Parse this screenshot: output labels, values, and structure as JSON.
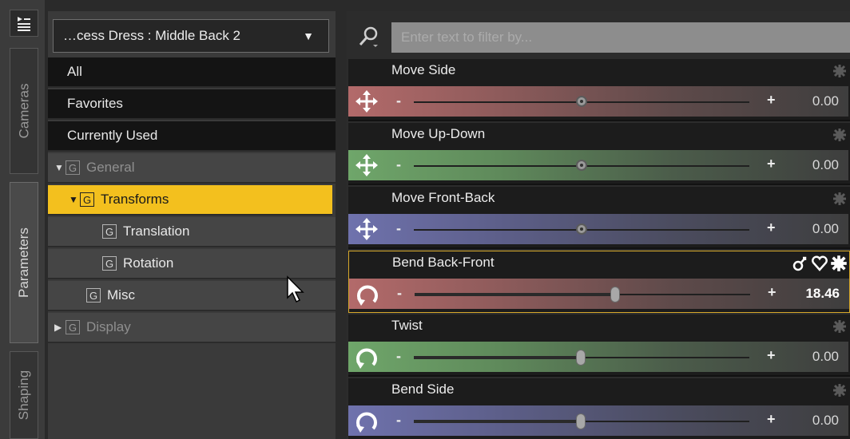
{
  "tabs": [
    {
      "label": "Cameras",
      "icon": "cameras-tab"
    },
    {
      "label": "Parameters",
      "icon": "parameters-tab"
    },
    {
      "label": "Shaping",
      "icon": "shaping-tab"
    }
  ],
  "node_selector": {
    "label": "…cess Dress : Middle Back 2",
    "arrow": "▼"
  },
  "tree": {
    "items": [
      {
        "label": "All"
      },
      {
        "label": "Favorites"
      },
      {
        "label": "Currently Used"
      },
      {
        "label": "General",
        "expanded": true,
        "group_glyph": "G"
      },
      {
        "label": "Transforms",
        "expanded": true,
        "selected": true,
        "group_glyph": "G"
      },
      {
        "label": "Translation",
        "group_glyph": "G"
      },
      {
        "label": "Rotation",
        "group_glyph": "G"
      },
      {
        "label": "Misc",
        "group_glyph": "G"
      },
      {
        "label": "Display",
        "expanded": false,
        "group_glyph": "G"
      }
    ]
  },
  "filter": {
    "placeholder": "Enter text to filter by..."
  },
  "parameters": [
    {
      "name": "Move Side",
      "value": "0.00",
      "minus": "-",
      "plus": "+",
      "color": "#b36a6a",
      "control": "translate-icon",
      "position": 0.5
    },
    {
      "name": "Move Up-Down",
      "value": "0.00",
      "minus": "-",
      "plus": "+",
      "color": "#6fa66a",
      "control": "translate-icon",
      "position": 0.5
    },
    {
      "name": "Move Front-Back",
      "value": "0.00",
      "minus": "-",
      "plus": "+",
      "color": "#6f72ad",
      "control": "translate-icon",
      "position": 0.5
    },
    {
      "name": "Bend Back-Front",
      "value": "18.46",
      "minus": "-",
      "plus": "+",
      "color": "#b36a6a",
      "control": "rotate-icon",
      "position": 0.6,
      "active": true
    },
    {
      "name": "Twist",
      "value": "0.00",
      "minus": "-",
      "plus": "+",
      "color": "#6fa66a",
      "control": "rotate-icon",
      "position": 0.5
    },
    {
      "name": "Bend Side",
      "value": "0.00",
      "minus": "-",
      "plus": "+",
      "color": "#6f72ad",
      "control": "rotate-icon",
      "position": 0.5
    }
  ],
  "colors": {
    "accent": "#f3c01e",
    "active_border": "#d7a82a"
  }
}
